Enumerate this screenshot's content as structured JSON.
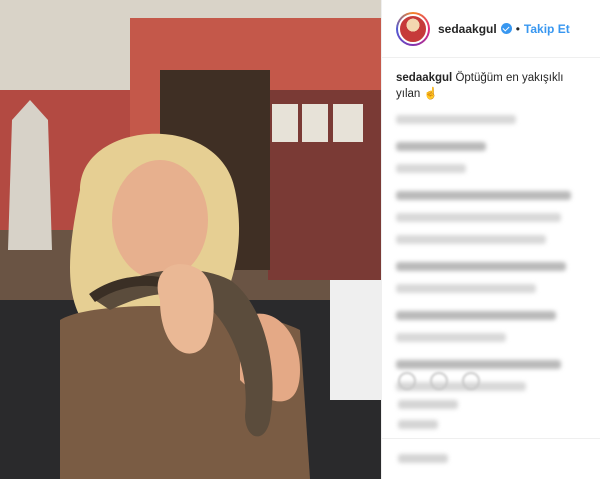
{
  "post": {
    "username": "sedaakgul",
    "follow_label": "Takip Et",
    "dot": "•",
    "caption_user": "sedaakgul",
    "caption_text": "Öptüğüm en yakışıklı yılan",
    "caption_emoji": "☝"
  },
  "colors": {
    "link": "#3897f0",
    "text": "#262626",
    "border": "#efefef"
  },
  "icons": [
    "verified-badge-icon",
    "like-icon",
    "comment-icon",
    "share-icon"
  ]
}
